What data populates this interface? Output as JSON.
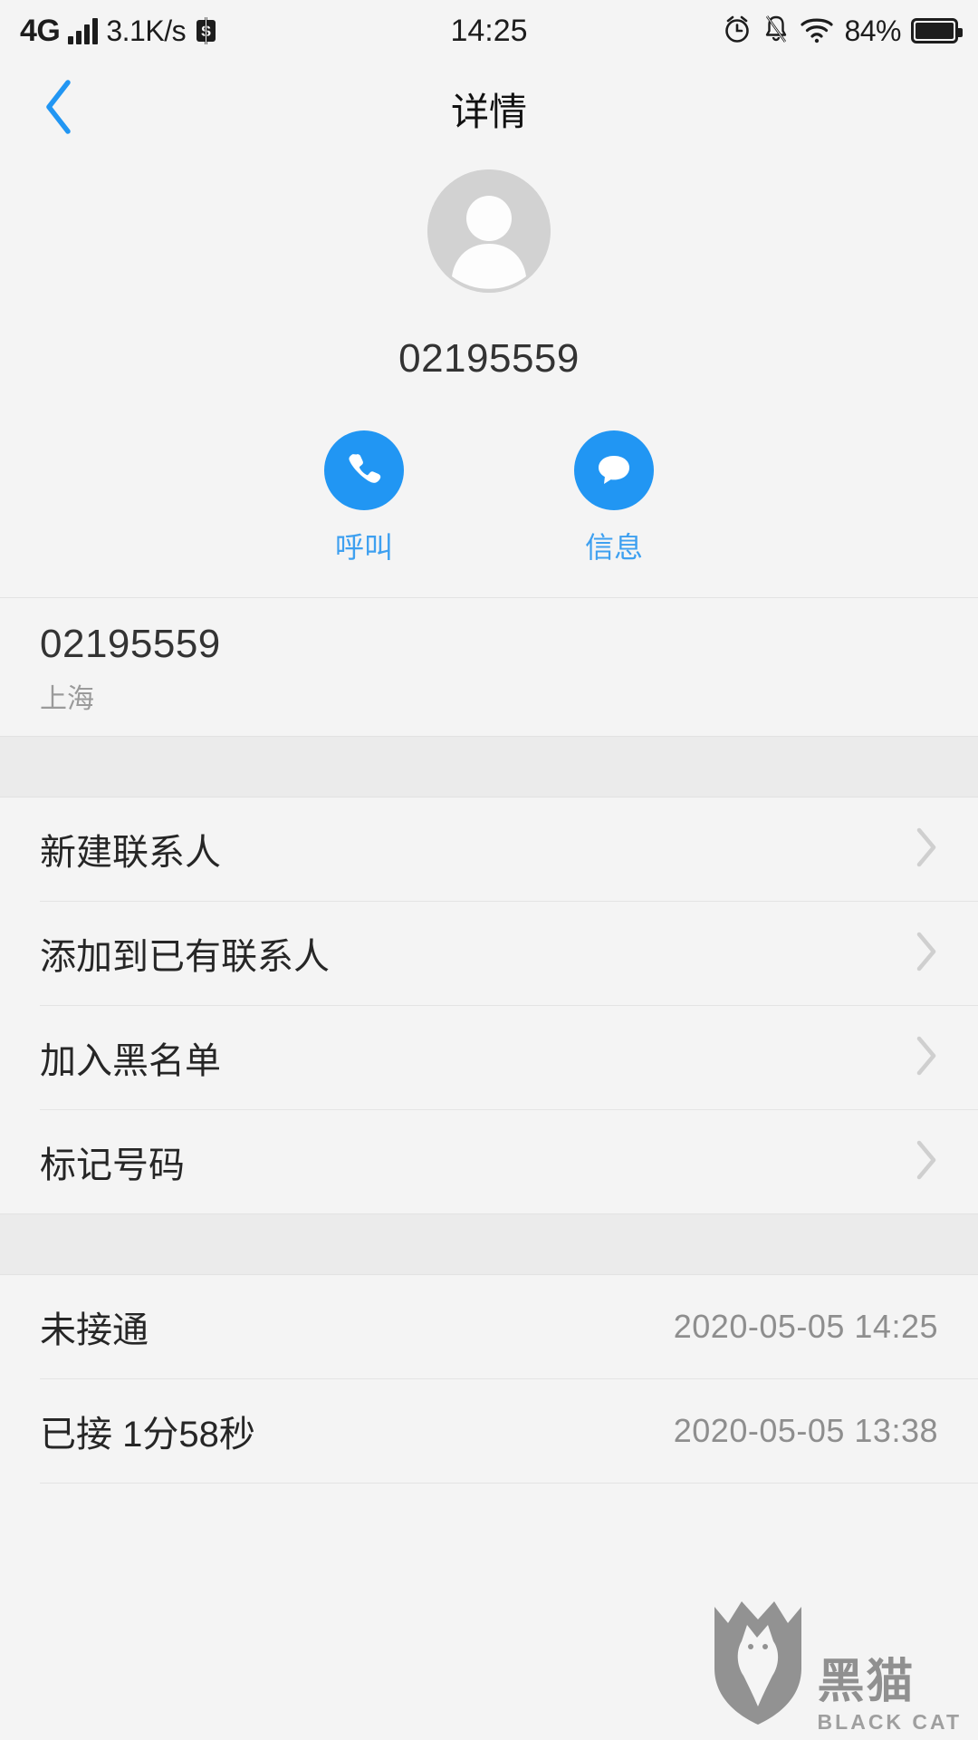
{
  "statusbar": {
    "network": "4G",
    "signal_icon": "signal-bars-icon",
    "speed": "3.1K/s",
    "app_icon": "s-badge-icon",
    "time": "14:25",
    "alarm_icon": "alarm-clock-icon",
    "mute_icon": "bell-muted-icon",
    "wifi_icon": "wifi-icon",
    "battery_percent": "84%",
    "battery_icon": "battery-icon"
  },
  "navbar": {
    "back_icon": "chevron-left-icon",
    "title": "详情"
  },
  "profile": {
    "avatar_icon": "default-person-avatar-icon",
    "number": "02195559"
  },
  "actions": [
    {
      "icon": "phone-icon",
      "label": "呼叫"
    },
    {
      "icon": "message-bubble-icon",
      "label": "信息"
    }
  ],
  "number_block": {
    "number": "02195559",
    "location": "上海"
  },
  "menu": [
    {
      "label": "新建联系人",
      "chevron_icon": "chevron-right-icon"
    },
    {
      "label": "添加到已有联系人",
      "chevron_icon": "chevron-right-icon"
    },
    {
      "label": "加入黑名单",
      "chevron_icon": "chevron-right-icon"
    },
    {
      "label": "标记号码",
      "chevron_icon": "chevron-right-icon"
    }
  ],
  "call_log": [
    {
      "state": "未接通",
      "time": "2020-05-05 14:25"
    },
    {
      "state": "已接 1分58秒",
      "time": "2020-05-05 13:38"
    }
  ],
  "watermark": {
    "shield_icon": "black-cat-shield-icon",
    "cn": "黑猫",
    "en": "BLACK CAT"
  },
  "colors": {
    "accent": "#2196f3",
    "accent_label": "#3ea0f0",
    "page_bg": "#f4f4f4",
    "band_bg": "#ebebeb"
  }
}
